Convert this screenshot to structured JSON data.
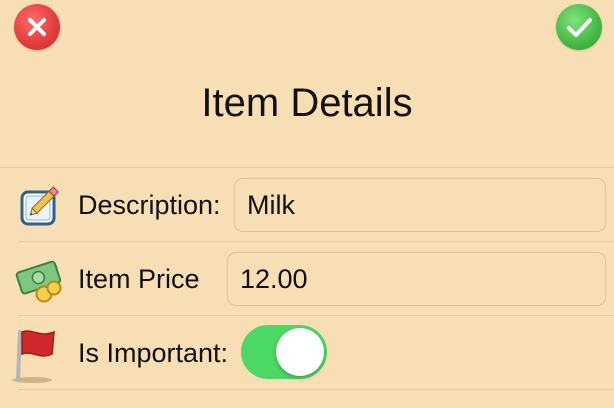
{
  "header": {
    "title": "Item Details",
    "cancel_icon": "close-icon",
    "confirm_icon": "checkmark-icon",
    "cancel_color": "#e23b3b",
    "confirm_color": "#44b944"
  },
  "form": {
    "description": {
      "label": "Description:",
      "value": "Milk",
      "icon": "pencil-notepad-icon"
    },
    "price": {
      "label": "Item Price",
      "value": "12.00",
      "icon": "money-icon"
    },
    "important": {
      "label": "Is Important:",
      "on": true,
      "icon": "red-flag-icon",
      "toggle_color": "#4cd864"
    }
  },
  "colors": {
    "background": "#f7deb4",
    "separator": "#e7c99a"
  }
}
